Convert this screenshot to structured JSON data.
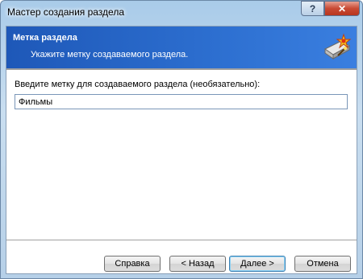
{
  "window": {
    "title": "Мастер создания раздела"
  },
  "titlebar": {
    "help_glyph": "?",
    "close_glyph": "✕"
  },
  "banner": {
    "title": "Метка раздела",
    "subtitle": "Укажите метку создаваемого раздела.",
    "icon": "disk-wizard-icon"
  },
  "form": {
    "prompt": "Введите метку для создаваемого раздела (необязательно):",
    "label_value": "Фильмы"
  },
  "buttons": {
    "help": "Справка",
    "back": "< Назад",
    "next": "Далее >",
    "cancel": "Отмена"
  },
  "colors": {
    "banner": "#2d6fd0",
    "close": "#c94a34"
  }
}
